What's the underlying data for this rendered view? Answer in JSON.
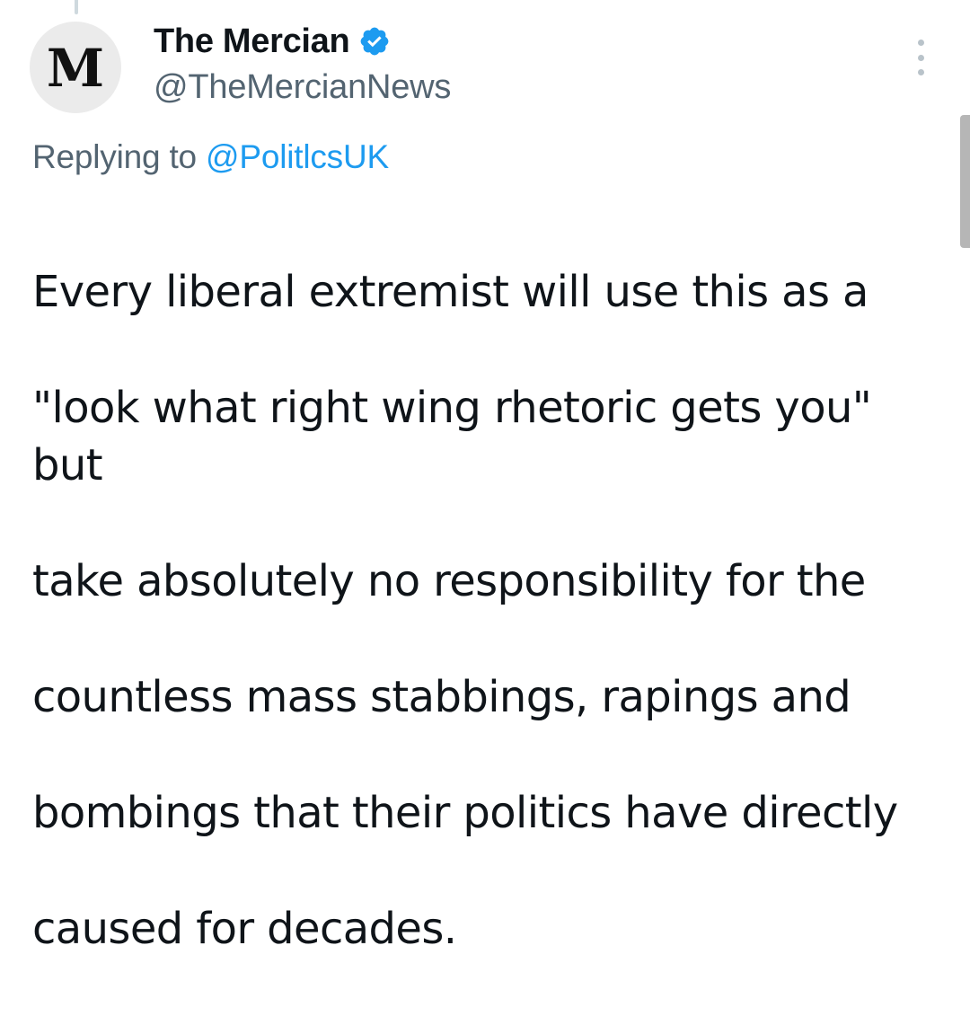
{
  "tweet": {
    "author": {
      "avatar_letter": "M",
      "display_name": "The Mercian",
      "handle": "@TheMercianNews",
      "verified": true,
      "verified_color": "#1d9bf0"
    },
    "reply": {
      "prefix": "Replying to",
      "mention": "@PolitlcsUK"
    },
    "text_lines": [
      "Every liberal extremist will use this as a",
      "\"look what right wing rhetoric gets you\" but",
      "take absolutely no responsibility for the",
      "countless mass stabbings, rapings and",
      "bombings that their politics have directly",
      "caused for decades."
    ],
    "more_icon": "vertical-ellipsis-icon"
  }
}
